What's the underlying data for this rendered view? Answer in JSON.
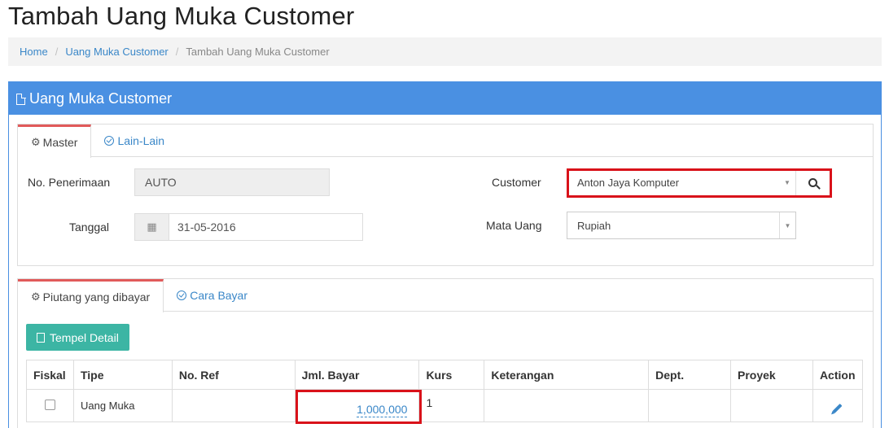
{
  "page": {
    "title": "Tambah Uang Muka Customer"
  },
  "breadcrumb": {
    "items": [
      "Home",
      "Uang Muka Customer"
    ],
    "current": "Tambah Uang Muka Customer"
  },
  "panel": {
    "title": "Uang Muka Customer"
  },
  "master_tabs": [
    {
      "label": "Master",
      "active": true
    },
    {
      "label": "Lain-Lain",
      "active": false
    }
  ],
  "form": {
    "no_penerimaan_label": "No. Penerimaan",
    "no_penerimaan_value": "AUTO",
    "tanggal_label": "Tanggal",
    "tanggal_value": "31-05-2016",
    "customer_label": "Customer",
    "customer_value": "Anton Jaya Komputer",
    "mata_uang_label": "Mata Uang",
    "mata_uang_value": "Rupiah"
  },
  "detail_tabs": [
    {
      "label": "Piutang yang dibayar",
      "active": true
    },
    {
      "label": "Cara Bayar",
      "active": false
    }
  ],
  "tempel_button": "Tempel Detail",
  "table": {
    "headers": [
      "Fiskal",
      "Tipe",
      "No. Ref",
      "Jml. Bayar",
      "Kurs",
      "Keterangan",
      "Dept.",
      "Proyek",
      "Action"
    ],
    "rows": [
      {
        "fiskal": false,
        "tipe": "Uang Muka",
        "no_ref": "",
        "jml_bayar": "1,000,000",
        "kurs": "1",
        "keterangan": "",
        "dept": "",
        "proyek": ""
      }
    ]
  },
  "colors": {
    "primary": "#4a90e2",
    "link": "#3a87c8",
    "teal": "#3cb5a4",
    "highlight": "#d9121a",
    "tab_accent": "#e15a5a"
  },
  "icons": {
    "panel": "file-icon",
    "master_tab": "gears-icon",
    "lain_tab": "check-circle-icon",
    "calendar": "calendar-icon",
    "search": "search-icon",
    "tempel": "copy-icon",
    "action": "pencil-icon"
  }
}
